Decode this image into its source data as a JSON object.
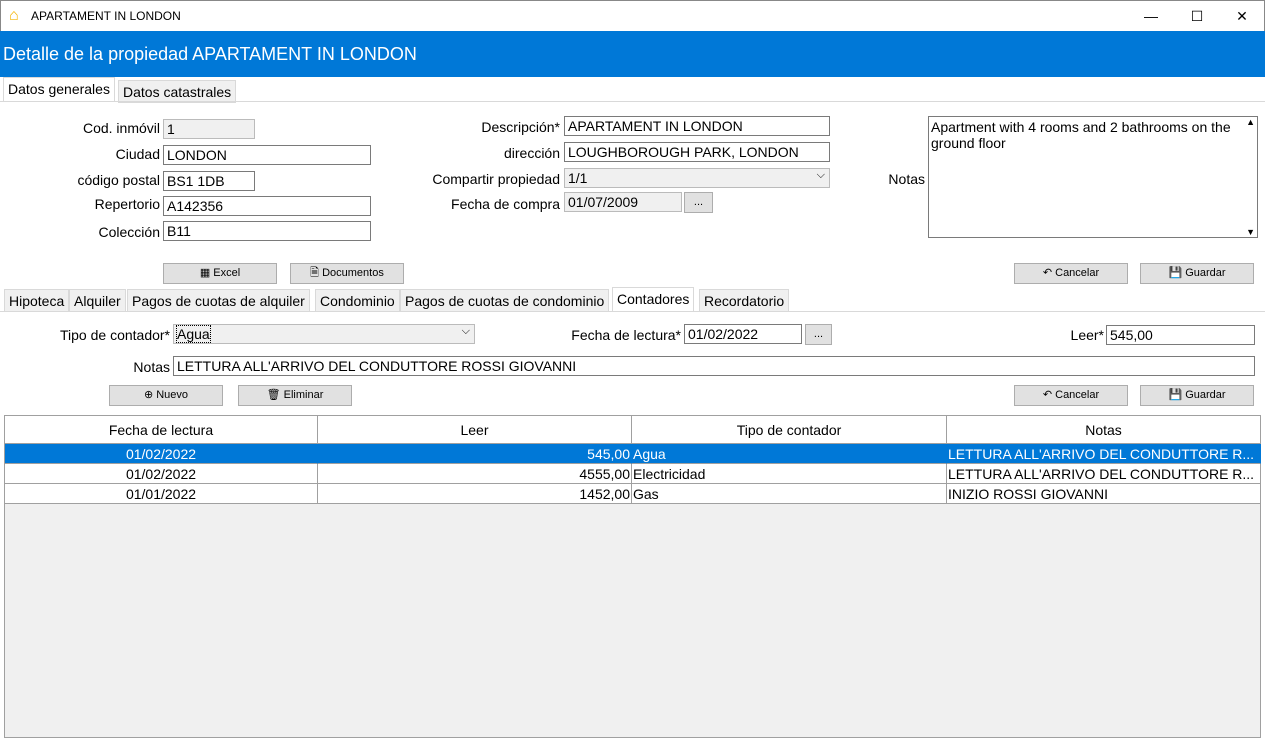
{
  "window": {
    "title": "APARTAMENT IN LONDON",
    "icon": "home-icon"
  },
  "header": {
    "title": "Detalle de la propiedad APARTAMENT IN LONDON"
  },
  "top_tabs": [
    {
      "label": "Datos generales",
      "active": true
    },
    {
      "label": "Datos catastrales"
    }
  ],
  "general": {
    "cod_label": "Cod. inmóvil",
    "cod_value": "1",
    "ciudad_label": "Ciudad",
    "ciudad_value": "LONDON",
    "cp_label": "código postal",
    "cp_value": "BS1 1DB",
    "repertorio_label": "Repertorio",
    "repertorio_value": "A142356",
    "coleccion_label": "Colección",
    "coleccion_value": "B11",
    "descripcion_label": "Descripción*",
    "descripcion_value": "APARTAMENT IN LONDON",
    "direccion_label": "dirección",
    "direccion_value": "LOUGHBOROUGH PARK, LONDON",
    "compartir_label": "Compartir propiedad",
    "compartir_value": "1/1",
    "fecha_label": "Fecha de compra",
    "fecha_value": "01/07/2009",
    "notas_label": "Notas",
    "notas_value": "Apartment with 4 rooms and 2 bathrooms on the ground floor",
    "excel": "Excel",
    "documentos": "Documentos",
    "cancelar": "Cancelar",
    "guardar": "Guardar",
    "dots": "..."
  },
  "sub_tabs": [
    {
      "label": "Hipoteca"
    },
    {
      "label": "Alquiler"
    },
    {
      "label": "Pagos de cuotas de alquiler"
    },
    {
      "label": "Condominio"
    },
    {
      "label": "Pagos de cuotas de condominio"
    },
    {
      "label": "Contadores",
      "active": true
    },
    {
      "label": "Recordatorio"
    }
  ],
  "contadores": {
    "tipo_label": "Tipo de contador*",
    "tipo_value": "Agua",
    "fecha_label": "Fecha de lectura*",
    "fecha_value": "01/02/2022",
    "leer_label": "Leer*",
    "leer_value": "545,00",
    "notas_label": "Notas",
    "notas_value": "LETTURA ALL'ARRIVO DEL CONDUTTORE ROSSI GIOVANNI",
    "nuevo": "Nuevo",
    "eliminar": "Eliminar",
    "cancelar": "Cancelar",
    "guardar": "Guardar",
    "dots": "..."
  },
  "table": {
    "columns": [
      "Fecha de lectura",
      "Leer",
      "Tipo de contador",
      "Notas"
    ],
    "rows": [
      [
        "01/02/2022",
        "545,00",
        "Agua",
        "LETTURA ALL'ARRIVO DEL CONDUTTORE R..."
      ],
      [
        "01/02/2022",
        "4555,00",
        "Electricidad",
        "LETTURA ALL'ARRIVO DEL CONDUTTORE R..."
      ],
      [
        "01/01/2022",
        "1452,00",
        "Gas",
        "INIZIO ROSSI GIOVANNI"
      ]
    ],
    "selected_row": 0
  },
  "colors": {
    "accent": "#0078d7"
  }
}
